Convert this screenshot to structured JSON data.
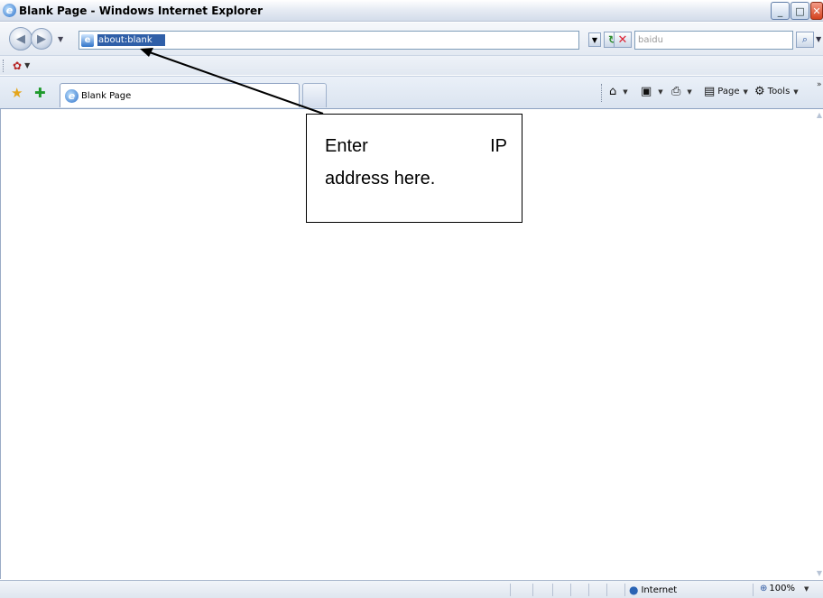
{
  "window": {
    "title": "Blank Page - Windows Internet Explorer",
    "minimize_icon": "minimize-icon",
    "maximize_icon": "maximize-icon",
    "close_icon": "close-icon"
  },
  "address_bar": {
    "url": "about:blank"
  },
  "search": {
    "placeholder": "baidu"
  },
  "tabs": [
    {
      "label": "Blank Page",
      "active": true
    }
  ],
  "command_bar": {
    "page_label": "Page",
    "tools_label": "Tools"
  },
  "annotation": {
    "line1_left": "Enter",
    "line1_right": "IP",
    "line2": "address here."
  },
  "status_bar": {
    "zone": "Internet",
    "zoom": "100%"
  },
  "colors": {
    "accent": "#2b6fc8",
    "selection": "#2f5fa8"
  }
}
